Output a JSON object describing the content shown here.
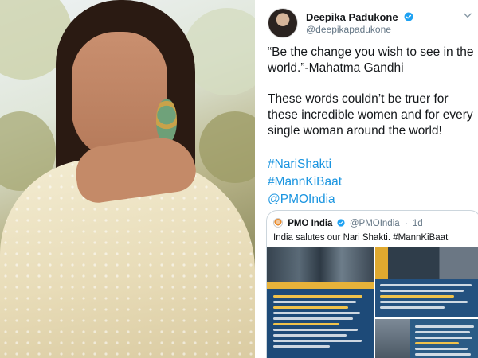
{
  "photo": {
    "subject_icon": "portrait-photo"
  },
  "tweet": {
    "author": {
      "name": "Deepika Padukone",
      "handle": "@deepikapadukone",
      "verified": true
    },
    "paragraphs": [
      "“Be the change you wish to see in the world.”-Mahatma Gandhi",
      "These words couldn’t be truer for these incredible women and for every single woman around the world!"
    ],
    "hashtags": [
      "#NariShakti",
      "#MannKiBaat",
      "@PMOIndia"
    ],
    "quoted": {
      "name": "PMO India",
      "handle": "@PMOIndia",
      "age": "1d",
      "text": "India salutes our Nari Shakti. #MannKiBaat"
    }
  },
  "colors": {
    "link": "#1b95e0",
    "verified": "#1da1f2",
    "text": "#14171a",
    "muted": "#657786",
    "media_blue": "#1d4a78"
  }
}
